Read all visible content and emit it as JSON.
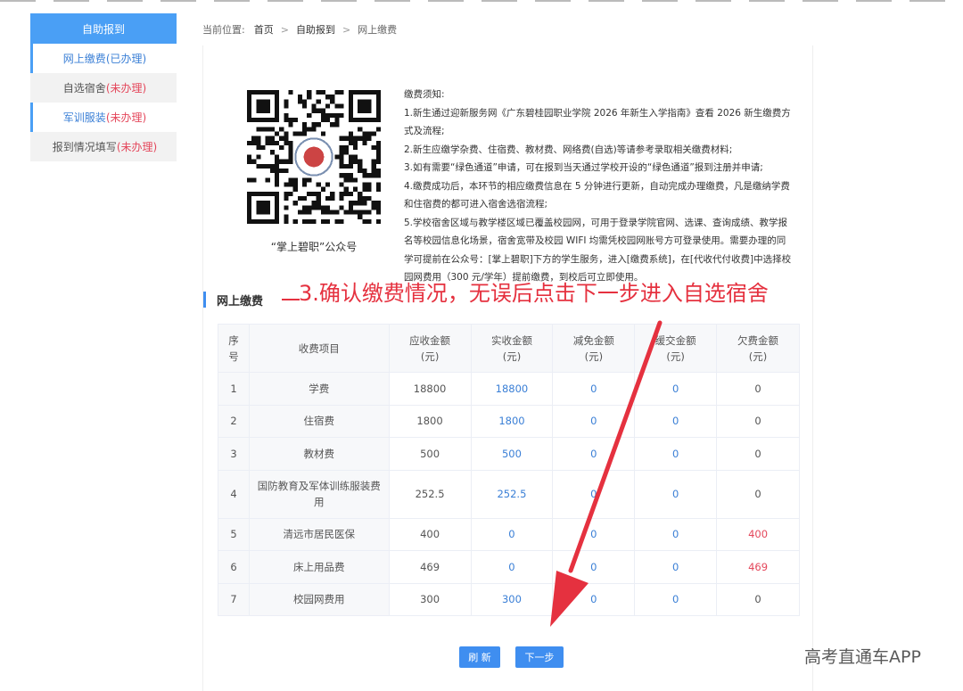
{
  "sidebar": {
    "header": "自助报到",
    "items": [
      {
        "name": "网上缴费",
        "status": "(已办理)",
        "status_type": "blue"
      },
      {
        "name": "自选宿舍",
        "status": "(未办理)",
        "status_type": "red"
      },
      {
        "name": "军训服装",
        "status": "(未办理)",
        "status_type": "red"
      },
      {
        "name": "报到情况填写",
        "status": "(未办理)",
        "status_type": "red"
      }
    ]
  },
  "breadcrumb": {
    "label": "当前位置:",
    "home": "首页",
    "level1": "自助报到",
    "current": "网上缴费",
    "sep": ">"
  },
  "qr": {
    "caption": "“掌上碧职”公众号"
  },
  "notice": {
    "title": "缴费须知:",
    "items": [
      "1.新生通过迎新服务网《广东碧桂园职业学院 2026 年新生入学指南》查看 2026 新生缴费方式及流程;",
      "2.新生应缴学杂费、住宿费、教材费、网络费(自选)等请参考录取相关缴费材料;",
      "3.如有需要“绿色通道”申请，可在报到当天通过学校开设的“绿色通道”报到注册并申请;",
      "4.缴费成功后，本环节的相应缴费信息在 5 分钟进行更新，自动完成办理缴费，凡是缴纳学费和住宿费的都可进入宿舍选宿流程;",
      "5.学校宿舍区域与教学楼区域已覆盖校园网，可用于登录学院官网、选课、查询成绩、教学报名等校园信息化场景，宿舍宽带及校园 WIFI 均需凭校园网账号方可登录使用。需要办理的同学可提前在公众号：[掌上碧职]下方的学生服务，进入[缴费系统]，在[代收代付收费]中选择校园网费用（300 元/学年）提前缴费，到校后可立即使用。"
    ]
  },
  "section_title": "网上缴费",
  "annotation": "3.确认缴费情况，无误后点击下一步进入自选宿舍",
  "table": {
    "headers": [
      "序号",
      "收费项目",
      "应收金额(元)",
      "实收金额(元)",
      "减免金额(元)",
      "缓交金额(元)",
      "欠费金额(元)"
    ],
    "header_lines": [
      [
        "序",
        "号"
      ],
      [
        "收费项目"
      ],
      [
        "应收金额",
        "(元)"
      ],
      [
        "实收金额",
        "(元)"
      ],
      [
        "减免金额",
        "(元)"
      ],
      [
        "缓交金额",
        "(元)"
      ],
      [
        "欠费金额",
        "(元)"
      ]
    ],
    "rows": [
      {
        "no": "1",
        "item": "学费",
        "due": "18800",
        "paid": "18800",
        "waived": "0",
        "deferred": "0",
        "owed": "0",
        "owed_red": false,
        "tall": false
      },
      {
        "no": "2",
        "item": "住宿费",
        "due": "1800",
        "paid": "1800",
        "waived": "0",
        "deferred": "0",
        "owed": "0",
        "owed_red": false,
        "tall": false
      },
      {
        "no": "3",
        "item": "教材费",
        "due": "500",
        "paid": "500",
        "waived": "0",
        "deferred": "0",
        "owed": "0",
        "owed_red": false,
        "tall": false
      },
      {
        "no": "4",
        "item": "国防教育及军体训练服装费用",
        "due": "252.5",
        "paid": "252.5",
        "waived": "0",
        "deferred": "0",
        "owed": "0",
        "owed_red": false,
        "tall": true
      },
      {
        "no": "5",
        "item": "清远市居民医保",
        "due": "400",
        "paid": "0",
        "waived": "0",
        "deferred": "0",
        "owed": "400",
        "owed_red": true,
        "tall": false
      },
      {
        "no": "6",
        "item": "床上用品费",
        "due": "469",
        "paid": "0",
        "waived": "0",
        "deferred": "0",
        "owed": "469",
        "owed_red": true,
        "tall": false
      },
      {
        "no": "7",
        "item": "校园网费用",
        "due": "300",
        "paid": "300",
        "waived": "0",
        "deferred": "0",
        "owed": "0",
        "owed_red": false,
        "tall": false
      }
    ]
  },
  "buttons": {
    "refresh": "刷 新",
    "next": "下一步"
  },
  "watermark": "高考直通车APP",
  "colors": {
    "primary": "#3f8ef0",
    "sidebar_header": "#4a9ff5",
    "link_blue": "#3a7fd6",
    "owed_red": "#e4475b",
    "annotation_red": "#e5313f"
  }
}
